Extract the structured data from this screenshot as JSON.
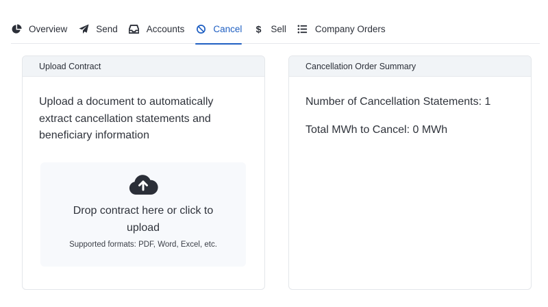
{
  "nav": {
    "tabs": [
      {
        "label": "Overview",
        "icon": "pie-chart-icon"
      },
      {
        "label": "Send",
        "icon": "paper-plane-icon"
      },
      {
        "label": "Accounts",
        "icon": "inbox-icon"
      },
      {
        "label": "Cancel",
        "icon": "ban-icon",
        "active": true
      },
      {
        "label": "Sell",
        "icon": "dollar-icon"
      },
      {
        "label": "Company Orders",
        "icon": "list-icon"
      }
    ],
    "accent_color": "#1f5fc2"
  },
  "upload": {
    "title": "Upload Contract",
    "description": "Upload a document to automatically extract cancellation statements and beneficiary information",
    "drop_text": "Drop contract here or click to upload",
    "formats": "Supported formats: PDF, Word, Excel, etc.",
    "icon": "cloud-upload-icon"
  },
  "summary": {
    "title": "Cancellation Order Summary",
    "statements": "Number of Cancellation Statements: 1",
    "mwh": "Total MWh to Cancel: 0 MWh"
  }
}
